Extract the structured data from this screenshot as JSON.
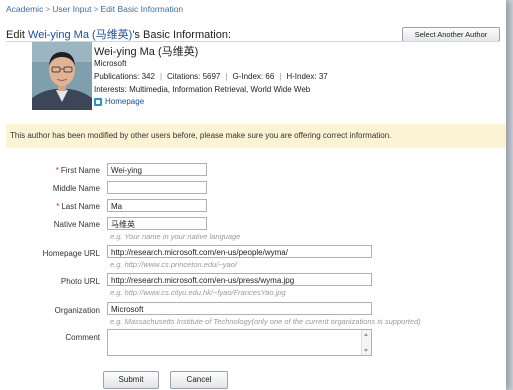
{
  "breadcrumb": {
    "items": [
      "Academic",
      "User Input",
      "Edit Basic Information"
    ],
    "separator": ">"
  },
  "title": {
    "prefix": "Edit ",
    "author": "Wei-ying Ma (马维英)",
    "suffix": "'s Basic Information:"
  },
  "select_author_label": "Select Another Author",
  "profile": {
    "name": "Wei-ying Ma (马维英)",
    "organization": "Microsoft",
    "stats": {
      "publications": "Publications: 342",
      "citations": "Citations: 5697",
      "g_index": "G-Index: 66",
      "h_index": "H-Index: 37"
    },
    "interests": "Interests: Multimedia,  Information Retrieval,  World Wide Web",
    "homepage_label": "Homepage"
  },
  "warning": "This author has been modified by other users before, please make sure you are offering correct information.",
  "form": {
    "first_name": {
      "label": "First Name",
      "value": "Wei-ying"
    },
    "middle_name": {
      "label": "Middle Name",
      "value": ""
    },
    "last_name": {
      "label": "Last Name",
      "value": "Ma"
    },
    "native_name": {
      "label": "Native Name",
      "value": "马维英",
      "hint": "e.g. Your name in your native language"
    },
    "homepage_url": {
      "label": "Homepage URL",
      "value": "http://research.microsoft.com/en-us/people/wyma/",
      "hint": "e.g. http://www.cs.princeton.edu/~yao/"
    },
    "photo_url": {
      "label": "Photo URL",
      "value": "http://research.microsoft.com/en-us/press/wyma.jpg",
      "hint": "e.g. http://www.cs.cityu.edu.hk/~fyao/FrancesYao.jpg"
    },
    "organization": {
      "label": "Organization",
      "value": "Microsoft",
      "hint": "e.g. Massachusetts Institute of Technology(only one of the current organizations is supported)"
    },
    "comment": {
      "label": "Comment",
      "value": ""
    },
    "required_mark": "*"
  },
  "buttons": {
    "submit": "Submit",
    "cancel": "Cancel"
  },
  "colors": {
    "link": "#1a4fa0",
    "warning_bg": "#fbf3d3",
    "required": "#dd2233"
  }
}
